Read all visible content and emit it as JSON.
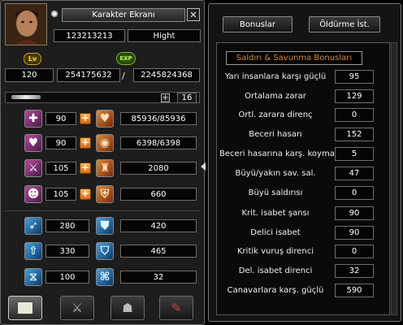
{
  "character": {
    "window_title": "Karakter Ekranı",
    "close_symbol": "✕",
    "id": "123213213",
    "name": "Hight",
    "lv_badge": "Lv",
    "exp_badge": "EXP",
    "level": "120",
    "exp_current": "254175632",
    "exp_separator": "/",
    "exp_max": "2245824368",
    "stat_points_plus": "+",
    "stat_points": "16"
  },
  "stats": [
    {
      "icon": "vitality-icon",
      "value": "90",
      "plus": "+",
      "result_icon": "heart-icon",
      "result": "85936/85936"
    },
    {
      "icon": "intelligence-icon",
      "value": "90",
      "plus": "+",
      "result_icon": "mana-icon",
      "result": "6398/6398"
    },
    {
      "icon": "strength-icon",
      "value": "105",
      "plus": "+",
      "result_icon": "attack-icon",
      "result": "2080"
    },
    {
      "icon": "dexterity-icon",
      "value": "105",
      "plus": "+",
      "result_icon": "defense-icon",
      "result": "660"
    }
  ],
  "secondary": [
    {
      "left": "280",
      "right": "420"
    },
    {
      "left": "330",
      "right": "465"
    },
    {
      "left": "100",
      "right": "32"
    }
  ],
  "bonus_panel": {
    "tab_bonuses": "Bonuslar",
    "tab_kills": "Öldürme İst.",
    "section_title": "Saldırı & Savunma Bonusları",
    "rows": [
      {
        "label": "Yarı insanlara karşı güçlü",
        "value": "95"
      },
      {
        "label": "Ortalama zarar",
        "value": "129"
      },
      {
        "label": "Ortl. zarara direnç",
        "value": "0"
      },
      {
        "label": "Beceri hasarı",
        "value": "152"
      },
      {
        "label": "Beceri hasarına karş. koyma",
        "value": "5"
      },
      {
        "label": "Büyü/yakın sav. sal.",
        "value": "47"
      },
      {
        "label": "Büyü saldırısı",
        "value": "0"
      },
      {
        "label": "Krit. isabet şansı",
        "value": "90"
      },
      {
        "label": "Delici isabet",
        "value": "90"
      },
      {
        "label": "Kritik vuruş direnci",
        "value": "0"
      },
      {
        "label": "Del. isabet direnci",
        "value": "32"
      },
      {
        "label": "Canavarlara karş. güçlü",
        "value": "590"
      }
    ]
  },
  "colors": {
    "accent": "#d58a3c",
    "hp": "#c0392b"
  }
}
